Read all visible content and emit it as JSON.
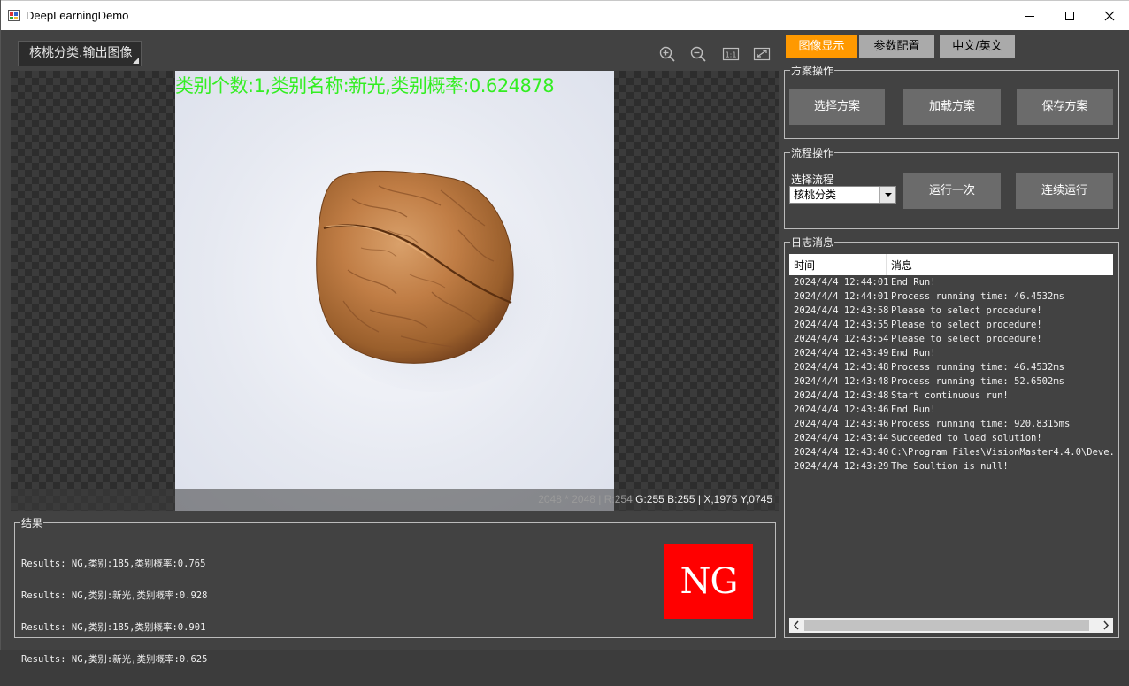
{
  "window": {
    "title": "DeepLearningDemo"
  },
  "viewer": {
    "tool_select": "核桃分类.输出图像",
    "overlay": "类别个数:1,类别名称:新光,类别概率:0.624878",
    "status": {
      "size": "2048 * 2048",
      "sep1": "|",
      "r": "R:254",
      "g": "G:255",
      "b": "B:255",
      "sep2": "|",
      "x": "X,1975",
      "y": "Y,0745"
    }
  },
  "results": {
    "legend": "结果",
    "lines": [
      "Results: NG,类别:185,类别概率:0.765",
      "Results: NG,类别:新光,类别概率:0.928",
      "Results: NG,类别:185,类别概率:0.901",
      "Results: NG,类别:新光,类别概率:0.625"
    ],
    "badge": "NG",
    "badge_color": "#ff0000"
  },
  "tabs": [
    {
      "label": "图像显示",
      "active": true,
      "color": "#ff9900"
    },
    {
      "label": "参数配置",
      "active": false
    },
    {
      "label": "中文/英文",
      "active": false
    }
  ],
  "solution_ops": {
    "legend": "方案操作",
    "buttons": [
      "选择方案",
      "加载方案",
      "保存方案"
    ]
  },
  "process_ops": {
    "legend": "流程操作",
    "select_label": "选择流程",
    "select_value": "核桃分类",
    "buttons": [
      "运行一次",
      "连续运行"
    ]
  },
  "log": {
    "legend": "日志消息",
    "col_time": "时间",
    "col_msg": "消息",
    "rows": [
      {
        "time": "2024/4/4 12:44:01",
        "msg": "End Run!"
      },
      {
        "time": "2024/4/4 12:44:01",
        "msg": "Process running time: 46.4532ms"
      },
      {
        "time": "2024/4/4 12:43:58",
        "msg": "Please to select procedure!"
      },
      {
        "time": "2024/4/4 12:43:55",
        "msg": "Please to select procedure!"
      },
      {
        "time": "2024/4/4 12:43:54",
        "msg": "Please to select procedure!"
      },
      {
        "time": "2024/4/4 12:43:49",
        "msg": "End Run!"
      },
      {
        "time": "2024/4/4 12:43:48",
        "msg": "Process running time: 46.4532ms"
      },
      {
        "time": "2024/4/4 12:43:48",
        "msg": "Process running time: 52.6502ms"
      },
      {
        "time": "2024/4/4 12:43:48",
        "msg": "Start continuous run!"
      },
      {
        "time": "2024/4/4 12:43:46",
        "msg": "End Run!"
      },
      {
        "time": "2024/4/4 12:43:46",
        "msg": "Process running time: 920.8315ms"
      },
      {
        "time": "2024/4/4 12:43:44",
        "msg": "Succeeded to load solution!"
      },
      {
        "time": "2024/4/4 12:43:40",
        "msg": "C:\\Program Files\\VisionMaster4.4.0\\Deve..."
      },
      {
        "time": "2024/4/4 12:43:29",
        "msg": "The Soultion is null!"
      }
    ]
  }
}
